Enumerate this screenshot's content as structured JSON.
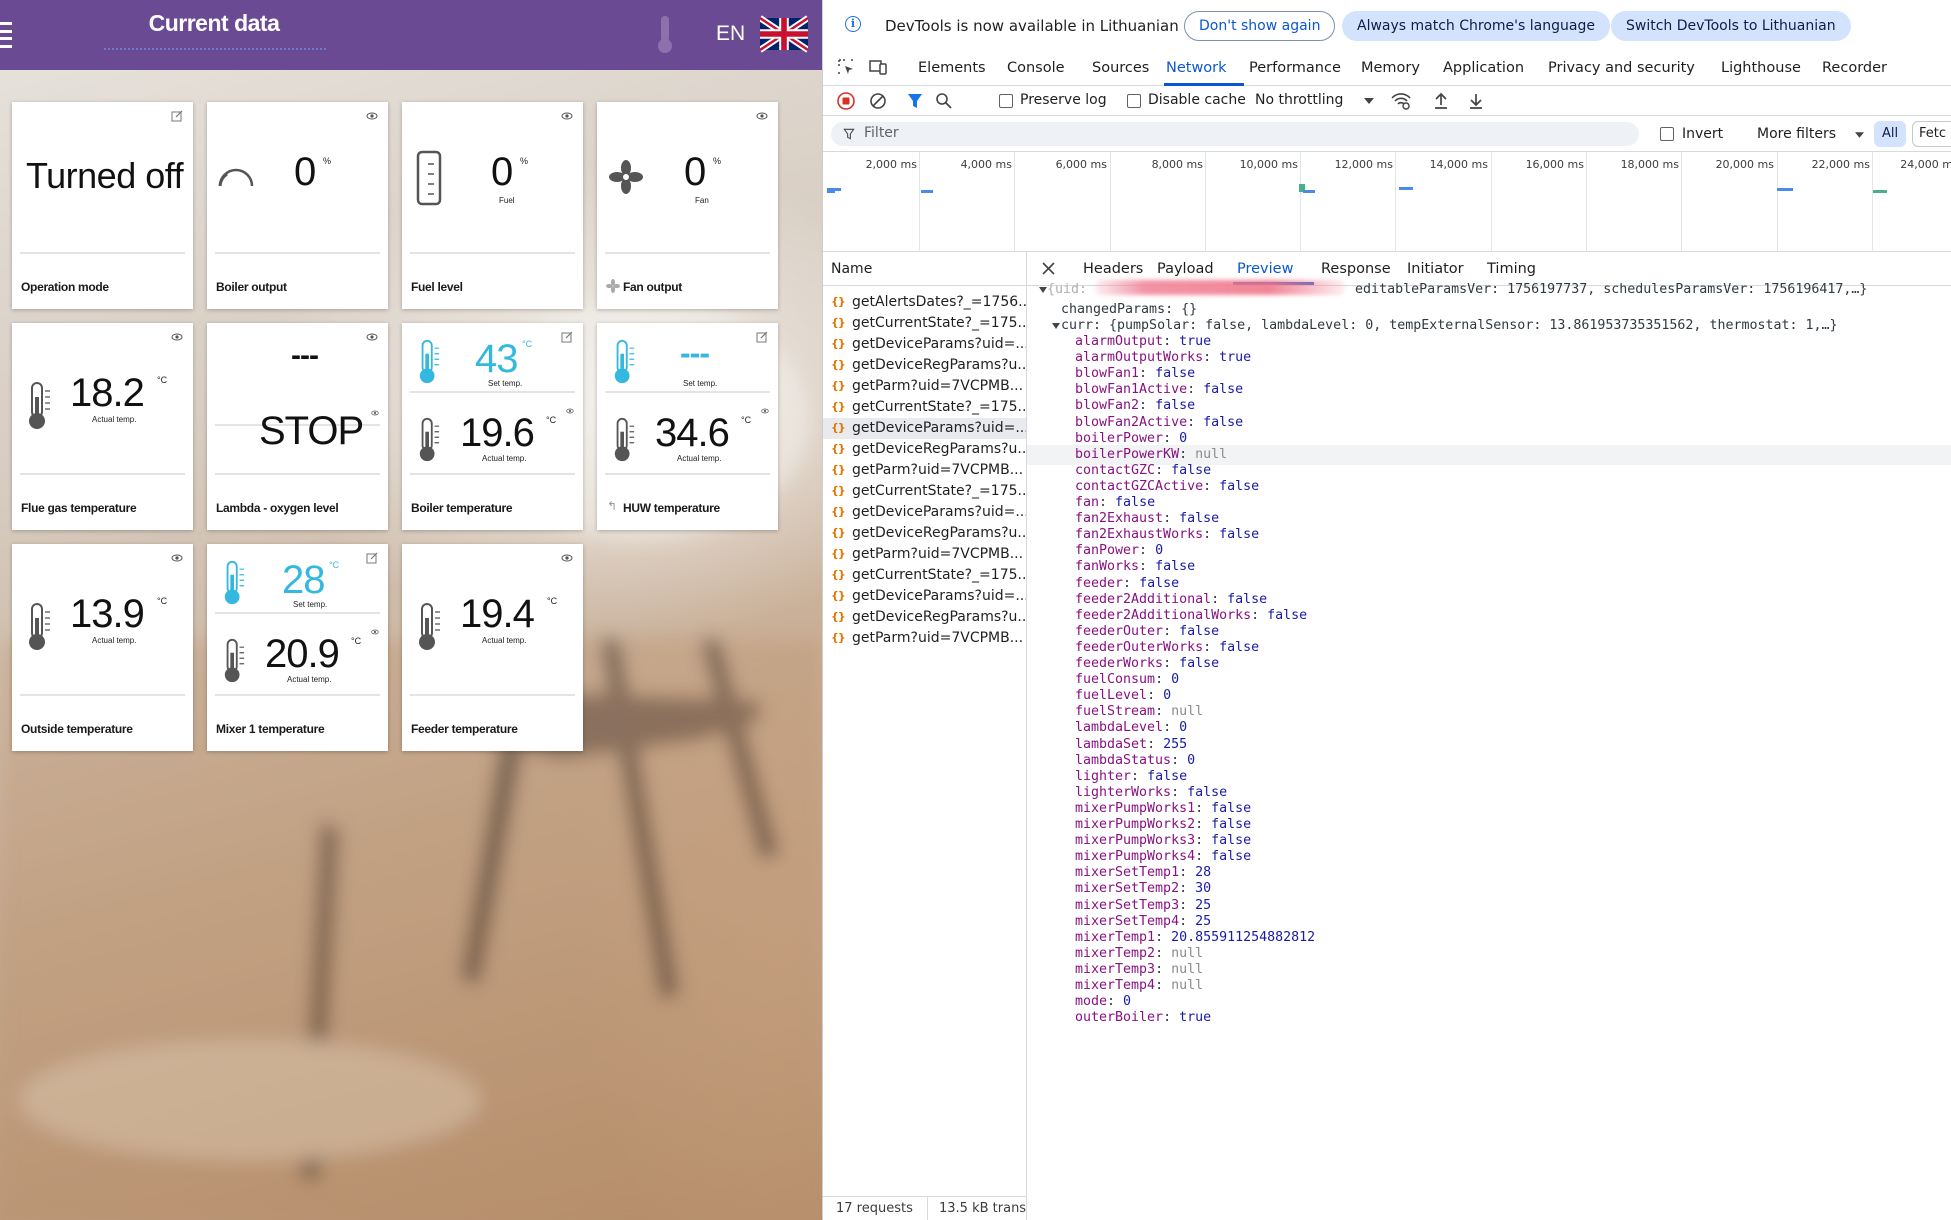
{
  "app": {
    "title": "Current data",
    "language": "EN",
    "cards": [
      {
        "id": "operation-mode",
        "value": "Turned off",
        "caption": "Operation mode"
      },
      {
        "id": "boiler-output",
        "value": "0",
        "unit": "%",
        "caption": "Boiler output"
      },
      {
        "id": "fuel-level",
        "value": "0",
        "unit": "%",
        "sublabel": "Fuel",
        "caption": "Fuel level"
      },
      {
        "id": "fan-output",
        "value": "0",
        "unit": "%",
        "sublabel": "Fan",
        "caption": "Fan output"
      },
      {
        "id": "flue-gas-temperature",
        "value": "18.2",
        "unit": "°C",
        "sublabel": "Actual temp.",
        "caption": "Flue gas temperature"
      },
      {
        "id": "lambda-oxygen-level",
        "top_value": "---",
        "value": "STOP",
        "caption": "Lambda - oxygen level"
      },
      {
        "id": "boiler-temperature",
        "set_value": "43",
        "set_unit": "°C",
        "set_label": "Set temp.",
        "value": "19.6",
        "unit": "°C",
        "sublabel": "Actual temp.",
        "caption": "Boiler temperature"
      },
      {
        "id": "huw-temperature",
        "set_value": "---",
        "set_label": "Set temp.",
        "value": "34.6",
        "unit": "°C",
        "sublabel": "Actual temp.",
        "caption": "HUW temperature"
      },
      {
        "id": "outside-temperature",
        "value": "13.9",
        "unit": "°C",
        "sublabel": "Actual temp.",
        "caption": "Outside temperature"
      },
      {
        "id": "mixer-1-temperature",
        "set_value": "28",
        "set_unit": "°C",
        "set_label": "Set temp.",
        "value": "20.9",
        "unit": "°C",
        "sublabel": "Actual temp.",
        "caption": "Mixer 1 temperature"
      },
      {
        "id": "feeder-temperature",
        "value": "19.4",
        "unit": "°C",
        "sublabel": "Actual temp.",
        "caption": "Feeder temperature"
      }
    ]
  },
  "devtools": {
    "infobar": {
      "text": "DevTools is now available in Lithuanian",
      "btn_dont_show": "Don't show again",
      "btn_match": "Always match Chrome's language",
      "btn_switch": "Switch DevTools to Lithuanian"
    },
    "tabs": [
      "Elements",
      "Console",
      "Sources",
      "Network",
      "Performance",
      "Memory",
      "Application",
      "Privacy and security",
      "Lighthouse",
      "Recorder"
    ],
    "active_tab": "Network",
    "toolbar": {
      "preserve_log": "Preserve log",
      "disable_cache": "Disable cache",
      "throttling": "No throttling"
    },
    "filter": {
      "placeholder": "Filter",
      "invert": "Invert",
      "more_filters": "More filters",
      "all": "All",
      "fetch": "Fetc"
    },
    "timeline_ticks": [
      "2,000 ms",
      "4,000 ms",
      "6,000 ms",
      "8,000 ms",
      "10,000 ms",
      "12,000 ms",
      "14,000 ms",
      "16,000 ms",
      "18,000 ms",
      "20,000 ms",
      "22,000 ms",
      "24,000 m"
    ],
    "name_header": "Name",
    "requests": [
      "getAlertsDates?_=1756...",
      "getCurrentState?_=175...",
      "getDeviceParams?uid=...",
      "getDeviceRegParams?u...",
      "getParm?uid=7VCPMB...",
      "getCurrentState?_=175...",
      "getDeviceParams?uid=...",
      "getDeviceRegParams?u...",
      "getParm?uid=7VCPMB...",
      "getCurrentState?_=175...",
      "getDeviceParams?uid=...",
      "getDeviceRegParams?u...",
      "getParm?uid=7VCPMB...",
      "getCurrentState?_=175...",
      "getDeviceParams?uid=...",
      "getDeviceRegParams?u...",
      "getParm?uid=7VCPMB..."
    ],
    "selected_request_index": 6,
    "status": {
      "requests": "17 requests",
      "transferred": "13.5 kB transf"
    },
    "detail_tabs": [
      "Headers",
      "Payload",
      "Preview",
      "Response",
      "Initiator",
      "Timing"
    ],
    "active_detail_tab": "Preview",
    "preview": {
      "root_prefix": "{uid: ",
      "root_suffix": "editableParamsVer: 1756197737, schedulesParamsVer: 1756196417,…}",
      "changed_params": "changedParams: {}",
      "curr_summary": "curr: {pumpSolar: false, lambdaLevel: 0, tempExternalSensor: 13.861953735351562, thermostat: 1,…}",
      "props": [
        {
          "k": "alarmOutput",
          "v": "true",
          "t": "b"
        },
        {
          "k": "alarmOutputWorks",
          "v": "true",
          "t": "b"
        },
        {
          "k": "blowFan1",
          "v": "false",
          "t": "b"
        },
        {
          "k": "blowFan1Active",
          "v": "false",
          "t": "b"
        },
        {
          "k": "blowFan2",
          "v": "false",
          "t": "b"
        },
        {
          "k": "blowFan2Active",
          "v": "false",
          "t": "b"
        },
        {
          "k": "boilerPower",
          "v": "0",
          "t": "n"
        },
        {
          "k": "boilerPowerKW",
          "v": "null",
          "t": "null"
        },
        {
          "k": "contactGZC",
          "v": "false",
          "t": "b"
        },
        {
          "k": "contactGZCActive",
          "v": "false",
          "t": "b"
        },
        {
          "k": "fan",
          "v": "false",
          "t": "b"
        },
        {
          "k": "fan2Exhaust",
          "v": "false",
          "t": "b"
        },
        {
          "k": "fan2ExhaustWorks",
          "v": "false",
          "t": "b"
        },
        {
          "k": "fanPower",
          "v": "0",
          "t": "n"
        },
        {
          "k": "fanWorks",
          "v": "false",
          "t": "b"
        },
        {
          "k": "feeder",
          "v": "false",
          "t": "b"
        },
        {
          "k": "feeder2Additional",
          "v": "false",
          "t": "b"
        },
        {
          "k": "feeder2AdditionalWorks",
          "v": "false",
          "t": "b"
        },
        {
          "k": "feederOuter",
          "v": "false",
          "t": "b"
        },
        {
          "k": "feederOuterWorks",
          "v": "false",
          "t": "b"
        },
        {
          "k": "feederWorks",
          "v": "false",
          "t": "b"
        },
        {
          "k": "fuelConsum",
          "v": "0",
          "t": "n"
        },
        {
          "k": "fuelLevel",
          "v": "0",
          "t": "n"
        },
        {
          "k": "fuelStream",
          "v": "null",
          "t": "null"
        },
        {
          "k": "lambdaLevel",
          "v": "0",
          "t": "n"
        },
        {
          "k": "lambdaSet",
          "v": "255",
          "t": "n"
        },
        {
          "k": "lambdaStatus",
          "v": "0",
          "t": "n"
        },
        {
          "k": "lighter",
          "v": "false",
          "t": "b"
        },
        {
          "k": "lighterWorks",
          "v": "false",
          "t": "b"
        },
        {
          "k": "mixerPumpWorks1",
          "v": "false",
          "t": "b"
        },
        {
          "k": "mixerPumpWorks2",
          "v": "false",
          "t": "b"
        },
        {
          "k": "mixerPumpWorks3",
          "v": "false",
          "t": "b"
        },
        {
          "k": "mixerPumpWorks4",
          "v": "false",
          "t": "b"
        },
        {
          "k": "mixerSetTemp1",
          "v": "28",
          "t": "n"
        },
        {
          "k": "mixerSetTemp2",
          "v": "30",
          "t": "n"
        },
        {
          "k": "mixerSetTemp3",
          "v": "25",
          "t": "n"
        },
        {
          "k": "mixerSetTemp4",
          "v": "25",
          "t": "n"
        },
        {
          "k": "mixerTemp1",
          "v": "20.855911254882812",
          "t": "n"
        },
        {
          "k": "mixerTemp2",
          "v": "null",
          "t": "null"
        },
        {
          "k": "mixerTemp3",
          "v": "null",
          "t": "null"
        },
        {
          "k": "mixerTemp4",
          "v": "null",
          "t": "null"
        },
        {
          "k": "mode",
          "v": "0",
          "t": "n"
        },
        {
          "k": "outerBoiler",
          "v": "true",
          "t": "b"
        }
      ],
      "highlighted_key": "boilerPowerKW"
    }
  }
}
